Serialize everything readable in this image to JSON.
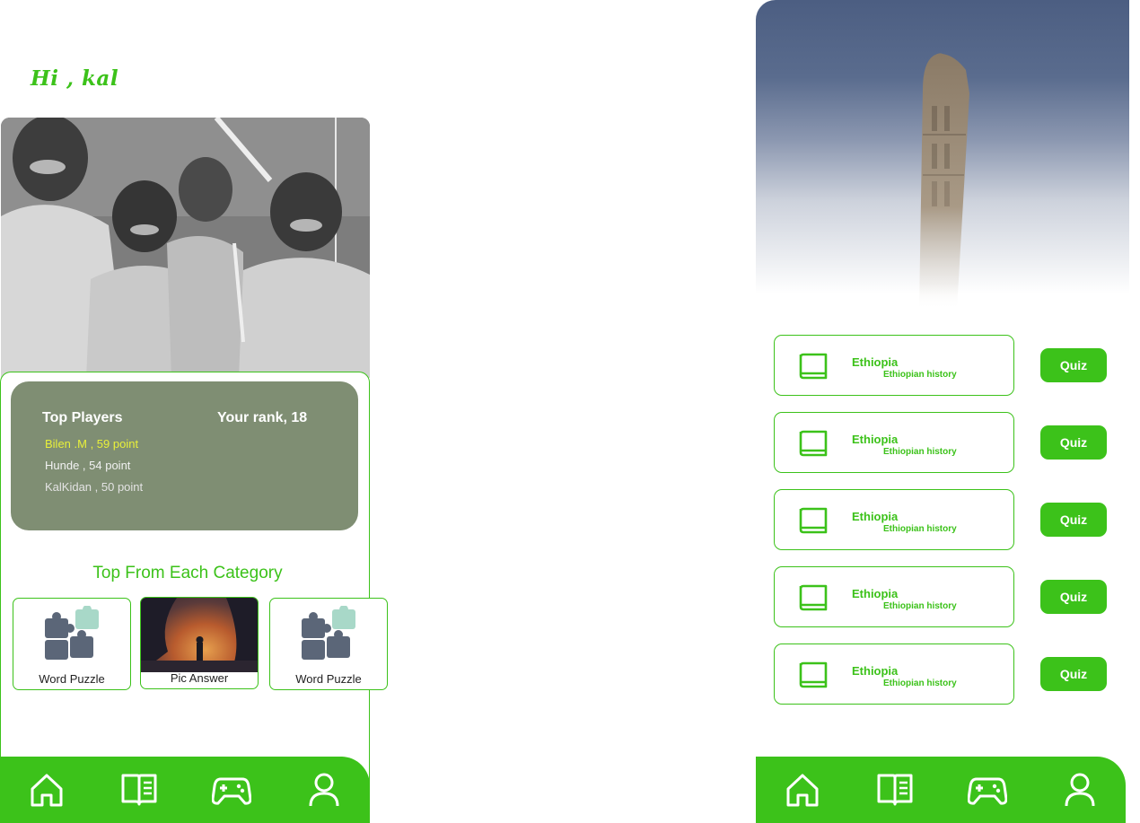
{
  "accent_color": "#3cc21a",
  "left": {
    "greeting": "Hi , kal",
    "top_players": {
      "title": "Top Players",
      "rank_text": "Your rank, 18",
      "players": [
        "Bilen .M , 59 point",
        "Hunde , 54 point",
        "KalKidan , 50 point"
      ]
    },
    "section_title": "Top From Each Category",
    "categories": [
      {
        "label": "Word Puzzle",
        "icon": "puzzle-icon"
      },
      {
        "label": "Pic Answer",
        "icon": "picture-thumbnail"
      },
      {
        "label": "Word Puzzle",
        "icon": "puzzle-icon"
      }
    ]
  },
  "right": {
    "quizzes": [
      {
        "title": "Ethiopia",
        "subtitle": "Ethiopian history",
        "button": "Quiz"
      },
      {
        "title": "Ethiopia",
        "subtitle": "Ethiopian history",
        "button": "Quiz"
      },
      {
        "title": "Ethiopia",
        "subtitle": "Ethiopian history",
        "button": "Quiz"
      },
      {
        "title": "Ethiopia",
        "subtitle": "Ethiopian history",
        "button": "Quiz"
      },
      {
        "title": "Ethiopia",
        "subtitle": "Ethiopian history",
        "button": "Quiz"
      }
    ]
  },
  "nav_icons": [
    "home-icon",
    "book-icon",
    "gamepad-icon",
    "profile-icon"
  ]
}
